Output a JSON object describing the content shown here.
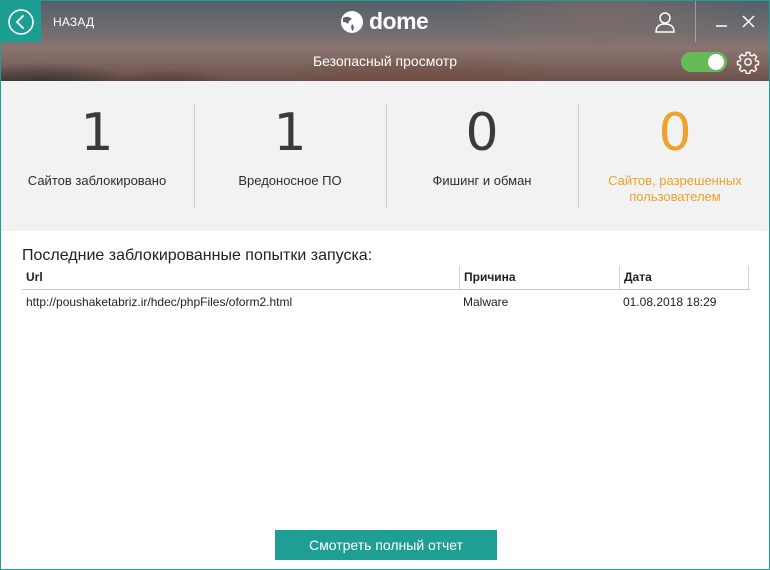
{
  "header": {
    "back_label": "НАЗАД",
    "logo_text": "dome",
    "title": "Безопасный просмотр",
    "toggle_on": true,
    "toggle_color": "#66bb58",
    "accent_color": "#1f9e93"
  },
  "stats": [
    {
      "value": "1",
      "label": "Сайтов заблокировано"
    },
    {
      "value": "1",
      "label": "Вредоносное ПО"
    },
    {
      "value": "0",
      "label": "Фишинг и обман"
    },
    {
      "value": "0",
      "label": "Сайтов, разрешенных пользователем",
      "color": "#f0a12a"
    }
  ],
  "blocked": {
    "title": "Последние заблокированные попытки запуска:",
    "columns": [
      "Url",
      "Причина",
      "Дата"
    ],
    "rows": [
      [
        "http://poushaketabriz.ir/hdec/phpFiles/oform2.html",
        "Malware",
        "01.08.2018 18:29"
      ]
    ]
  },
  "footer": {
    "report_button": "Смотреть полный отчет"
  },
  "icons": [
    "back-arrow-icon",
    "dome-logo-icon",
    "user-icon",
    "minimize-icon",
    "close-icon",
    "gear-icon"
  ]
}
